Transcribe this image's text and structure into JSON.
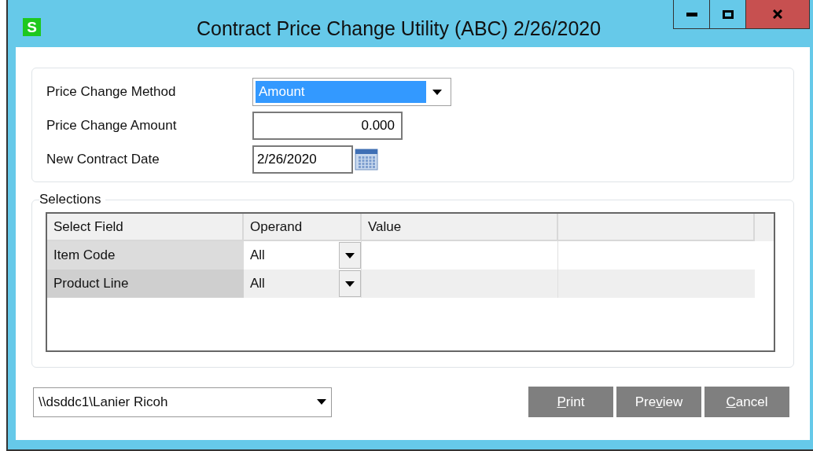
{
  "window": {
    "icon": "S",
    "title": "Contract Price Change Utility (ABC) 2/26/2020"
  },
  "fields": [
    {
      "kind": "dropdown",
      "label": "Price Change Method",
      "value": "Amount"
    },
    {
      "kind": "number",
      "label": "Price Change Amount",
      "value": "0.000"
    },
    {
      "kind": "date",
      "label": "New Contract Date",
      "value": "2/26/2020"
    }
  ],
  "selections": {
    "title": "Selections",
    "columns": [
      "Select Field",
      "Operand",
      "Value"
    ],
    "rows": [
      {
        "field": "Item Code",
        "operand": "All",
        "selected": true
      },
      {
        "field": "Product Line",
        "operand": "All",
        "selected": false
      }
    ]
  },
  "printer": {
    "value": "\\\\dsddc1\\Lanier Ricoh"
  },
  "buttons": [
    {
      "key": "P",
      "after": "rint"
    },
    {
      "before": "Pre",
      "key": "v",
      "after": "iew"
    },
    {
      "key": "C",
      "after": "ancel"
    }
  ]
}
